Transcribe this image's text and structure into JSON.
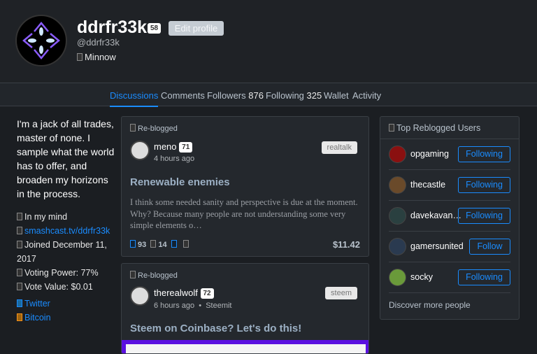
{
  "profile": {
    "name": "ddrfr33k",
    "reputation": "58",
    "edit_label": "Edit profile",
    "handle": "@ddrfr33k",
    "rank": "Minnow"
  },
  "tabs": [
    {
      "label": "Discussions"
    },
    {
      "label": "Comments"
    },
    {
      "label": "Followers",
      "count": "876"
    },
    {
      "label": "Following",
      "count": "325"
    },
    {
      "label": "Wallet"
    },
    {
      "label": "Activity"
    }
  ],
  "bio": "I'm a jack of all trades, master of none. I sample what the world has to offer, and broaden my horizons in the process.",
  "meta": {
    "location": "In my mind",
    "website": "smashcast.tv/ddrfr33k",
    "joined": "Joined December 11, 2017",
    "voting_power": "Voting Power: 77%",
    "vote_value": "Vote Value: $0.01"
  },
  "links": {
    "twitter": "Twitter",
    "bitcoin": "Bitcoin"
  },
  "posts": [
    {
      "reblog": "Re-blogged",
      "author": "meno",
      "rep": "71",
      "time": "4 hours ago",
      "tag": "realtalk",
      "title": "Renewable enemies",
      "body": "I think some needed sanity and perspective is due at the moment. Why? Because many people are not understanding some very simple elements o…",
      "votes": "93",
      "comments": "14",
      "payout": "$11.42"
    },
    {
      "reblog": "Re-blogged",
      "author": "therealwolf",
      "rep": "72",
      "time": "6 hours ago",
      "app": "Steemit",
      "tag": "steem",
      "title": "Steem on Coinbase? Let's do this!"
    }
  ],
  "sidebar": {
    "title": "Top Reblogged Users",
    "users": [
      {
        "name": "opgaming",
        "action": "Following"
      },
      {
        "name": "thecastle",
        "action": "Following"
      },
      {
        "name": "davekavan…",
        "action": "Following"
      },
      {
        "name": "gamersunited",
        "action": "Follow"
      },
      {
        "name": "socky",
        "action": "Following"
      }
    ],
    "discover": "Discover more people"
  },
  "colors": {
    "accent": "#1a8cff",
    "bg": "#1b1e22",
    "card": "#24282d"
  }
}
